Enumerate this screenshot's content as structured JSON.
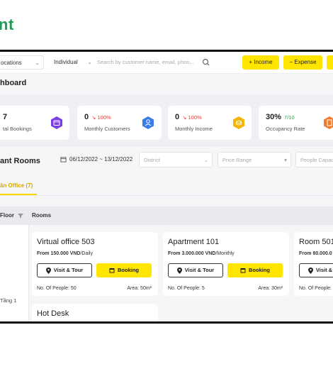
{
  "brand": {
    "text": "nt"
  },
  "topbar": {
    "locations": "ocations",
    "individual": "Individual",
    "search_placeholder": "Search by customer name, email, phon...",
    "income_label": "+  Income",
    "expense_label": "−  Expense"
  },
  "dashboard": {
    "title": "hboard"
  },
  "stats": [
    {
      "value": "7",
      "change": "",
      "label": "tal Bookings",
      "icon": "calendar-icon",
      "color": "#7b3fe4"
    },
    {
      "value": "0",
      "change": "↘ 100%",
      "label": "Monthly Customers",
      "icon": "users-icon",
      "color": "#3b7be8"
    },
    {
      "value": "0",
      "change": "↘ 100%",
      "label": "Monthly Income",
      "icon": "coins-icon",
      "color": "#f5b400"
    },
    {
      "value": "30%",
      "change": "7/10",
      "label": "Occupancy Rate",
      "icon": "building-icon",
      "color": "#f07b2b"
    }
  ],
  "rooms_section": {
    "title": "ant Rooms",
    "date_range": "06/12/2022  ~  13/12/2022",
    "district": "District",
    "price_range": "Price Range",
    "capacity": "People Capaci"
  },
  "tab": {
    "label": "ân Office (7)"
  },
  "table": {
    "floor_header": "Floor",
    "rooms_header": "Rooms",
    "floor_name": "Tầng 1"
  },
  "rooms": [
    {
      "name": "Virtual office 503",
      "price_prefix": "From ",
      "price": "150.000 VND",
      "price_suffix": "/Daily",
      "visit": "Visit & Tour",
      "booking": "Booking",
      "people": "No. Of People: 50",
      "area": "Area: 50m²"
    },
    {
      "name": "Apartment 101",
      "price_prefix": "From ",
      "price": "3.000.000 VND",
      "price_suffix": "/Monthly",
      "visit": "Visit & Tour",
      "booking": "Booking",
      "people": "No. Of People: 5",
      "area": "Area: 30m²"
    },
    {
      "name": "Room 501",
      "price_prefix": "From ",
      "price": "80.000.0",
      "price_suffix": "",
      "visit": "Visit &",
      "booking": "",
      "people": "No. Of People:",
      "area": ""
    }
  ],
  "room_next": {
    "name": "Hot Desk"
  },
  "colors": {
    "accent": "#ffe500",
    "brand": "#1f9d55",
    "down": "#e53935",
    "up": "#2e9e4f"
  }
}
